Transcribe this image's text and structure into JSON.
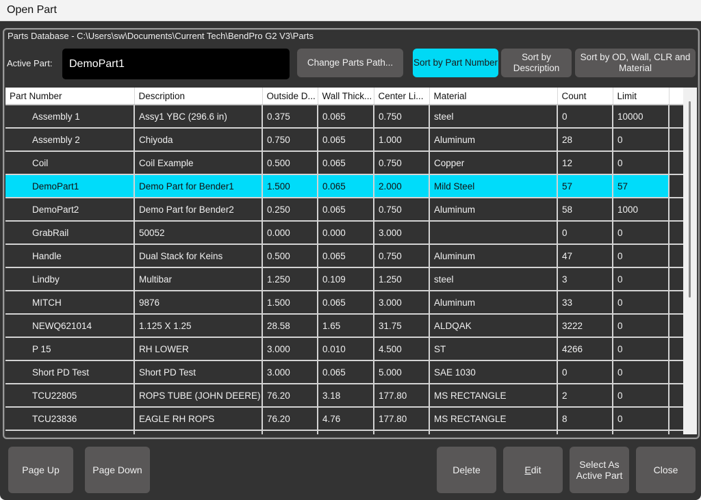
{
  "window": {
    "title": "Open Part"
  },
  "header": {
    "database_path": "Parts Database - C:\\Users\\sw\\Documents\\Current Tech\\BendPro G2 V3\\Parts",
    "active_part_label": "Active Part:",
    "active_part_value": "DemoPart1"
  },
  "toolbar": {
    "change_path_label": "Change Parts Path...",
    "sort_part_number_label": "Sort by Part Number",
    "sort_description_label": "Sort by Description",
    "sort_od_label": "Sort by OD, Wall, CLR and Material",
    "active_sort": "Sort by Part Number"
  },
  "colors": {
    "accent": "#00dcfa",
    "background": "#333333",
    "button": "#595757"
  },
  "table": {
    "columns": [
      "Part Number",
      "Description",
      "Outside D...",
      "Wall Thick...",
      "Center Li...",
      "Material",
      "Count",
      "Limit"
    ],
    "selected_index": 3,
    "rows": [
      {
        "part": "Assembly 1",
        "desc": "Assy1 YBC (296.6 in)",
        "od": "0.375",
        "wall": "0.065",
        "clr": "0.750",
        "material": "steel",
        "count": "0",
        "limit": "10000"
      },
      {
        "part": "Assembly 2",
        "desc": "Chiyoda",
        "od": "0.750",
        "wall": "0.065",
        "clr": "1.000",
        "material": "Aluminum",
        "count": "28",
        "limit": "0"
      },
      {
        "part": "Coil",
        "desc": "Coil Example",
        "od": "0.500",
        "wall": "0.065",
        "clr": "0.750",
        "material": "Copper",
        "count": "12",
        "limit": "0"
      },
      {
        "part": "DemoPart1",
        "desc": "Demo Part for Bender1",
        "od": "1.500",
        "wall": "0.065",
        "clr": "2.000",
        "material": "Mild Steel",
        "count": "57",
        "limit": "57"
      },
      {
        "part": "DemoPart2",
        "desc": "Demo Part for Bender2",
        "od": "0.250",
        "wall": "0.065",
        "clr": "0.750",
        "material": "Aluminum",
        "count": "58",
        "limit": "1000"
      },
      {
        "part": "GrabRail",
        "desc": "50052",
        "od": "0.000",
        "wall": "0.000",
        "clr": "3.000",
        "material": "",
        "count": "0",
        "limit": "0"
      },
      {
        "part": "Handle",
        "desc": "Dual Stack for Keins",
        "od": "0.500",
        "wall": "0.065",
        "clr": "0.750",
        "material": "Aluminum",
        "count": "47",
        "limit": "0"
      },
      {
        "part": "Lindby",
        "desc": "Multibar",
        "od": "1.250",
        "wall": "0.109",
        "clr": "1.250",
        "material": "steel",
        "count": "3",
        "limit": "0"
      },
      {
        "part": "MITCH",
        "desc": "9876",
        "od": "1.500",
        "wall": "0.065",
        "clr": "3.000",
        "material": "Aluminum",
        "count": "33",
        "limit": "0"
      },
      {
        "part": "NEWQ621014",
        "desc": "1.125 X 1.25",
        "od": "28.58",
        "wall": "1.65",
        "clr": "31.75",
        "material": "ALDQAK",
        "count": "3222",
        "limit": "0"
      },
      {
        "part": "P 15",
        "desc": "RH LOWER",
        "od": "3.000",
        "wall": "0.010",
        "clr": "4.500",
        "material": "ST",
        "count": "4266",
        "limit": "0"
      },
      {
        "part": "Short PD Test",
        "desc": "Short PD Test",
        "od": "3.000",
        "wall": "0.065",
        "clr": "5.000",
        "material": "SAE 1030",
        "count": "0",
        "limit": "0"
      },
      {
        "part": "TCU22805",
        "desc": "ROPS TUBE (JOHN DEERE)",
        "od": "76.20",
        "wall": "3.18",
        "clr": "177.80",
        "material": "MS RECTANGLE",
        "count": "2",
        "limit": "0"
      },
      {
        "part": "TCU23836",
        "desc": "EAGLE RH ROPS",
        "od": "76.20",
        "wall": "4.76",
        "clr": "177.80",
        "material": "MS RECTANGLE",
        "count": "8",
        "limit": "0"
      },
      {
        "part": "",
        "desc": "",
        "od": "",
        "wall": "",
        "clr": "",
        "material": "",
        "count": "",
        "limit": ""
      }
    ]
  },
  "footer": {
    "page_up_label": "Page Up",
    "page_down_label": "Page Down",
    "delete_pre": "De",
    "delete_key": "l",
    "delete_post": "ete",
    "edit_key": "E",
    "edit_post": "dit",
    "select_active_line1": "Select As",
    "select_active_line2": "Active Part",
    "close_label": "Close"
  }
}
